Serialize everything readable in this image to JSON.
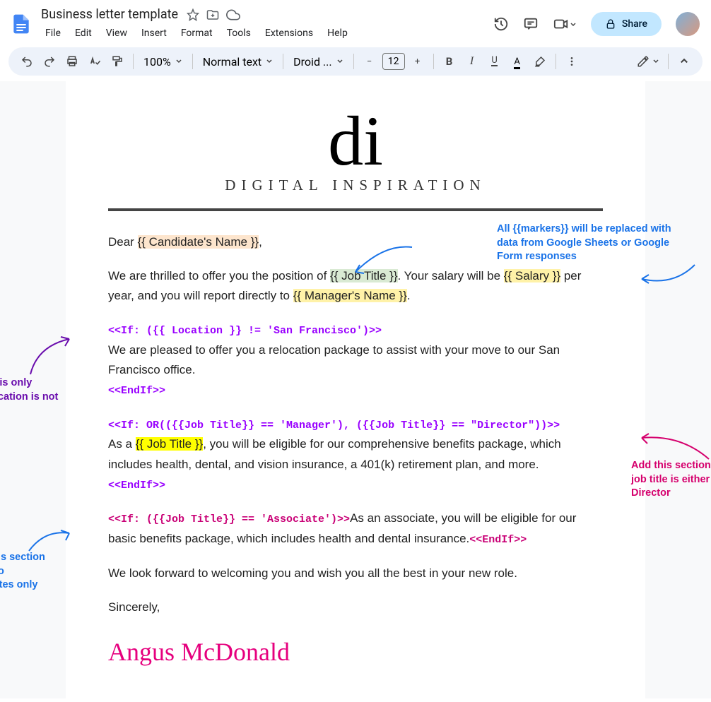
{
  "doc": {
    "title": "Business letter template"
  },
  "menu": {
    "file": "File",
    "edit": "Edit",
    "view": "View",
    "insert": "Insert",
    "format": "Format",
    "tools": "Tools",
    "extensions": "Extensions",
    "help": "Help"
  },
  "share": {
    "label": "Share"
  },
  "toolbar": {
    "zoom": "100%",
    "style": "Normal text",
    "font": "Droid ...",
    "fontsize": "12",
    "minus": "−",
    "plus": "+"
  },
  "logo": {
    "script": "di",
    "text": "DIGITAL INSPIRATION"
  },
  "letter": {
    "dear": "Dear ",
    "candidate": "{{ Candidate's Name }}",
    "comma": ",",
    "p1a": "We are thrilled to offer you the position of ",
    "jobtitle": "{{ Job Title }}",
    "p1b": ". Your salary will be ",
    "salary": "{{ Salary }}",
    "p1c": " per year, and you will report directly to ",
    "manager": "{{ Manager's Name }}",
    "p1d": ".",
    "if1": "<<If: ({{ Location }} != 'San Francisco')>>",
    "reloc": "We are pleased to offer you a relocation package to assist with your move to our San Francisco office.",
    "endif1": "<<EndIf>>",
    "if2": "<<If: OR(({{Job Title}} == 'Manager'), ({{Job Title}} == \"Director\"))>>",
    "asa": "As a ",
    "jobtitle2": "{{ Job Title }}",
    "benefits": ", you will be eligible for our comprehensive benefits package, which includes health, dental, and vision insurance, a 401(k) retirement plan, and more.",
    "endif2": "<<EndIf>>",
    "if3": "<<If: ({{Job Title}} == 'Associate')>>",
    "assoc": "As an associate, you will be eligible for our basic benefits package, which includes health and dental insurance.",
    "endif3": "<<EndIf>>",
    "closing": "We look forward to welcoming you and wish you all the best in your new role.",
    "sincerely": "Sincerely,",
    "signature": "Angus McDonald"
  },
  "annotations": {
    "markers": "All {{markers}} will be replaced with data from Google Sheets or Google Form responses",
    "sf": "Show this only when location is not SF",
    "mgrdir": "Add this section when the job title is either Manager or Director",
    "assoc": "Make this section visible to Associates only"
  }
}
